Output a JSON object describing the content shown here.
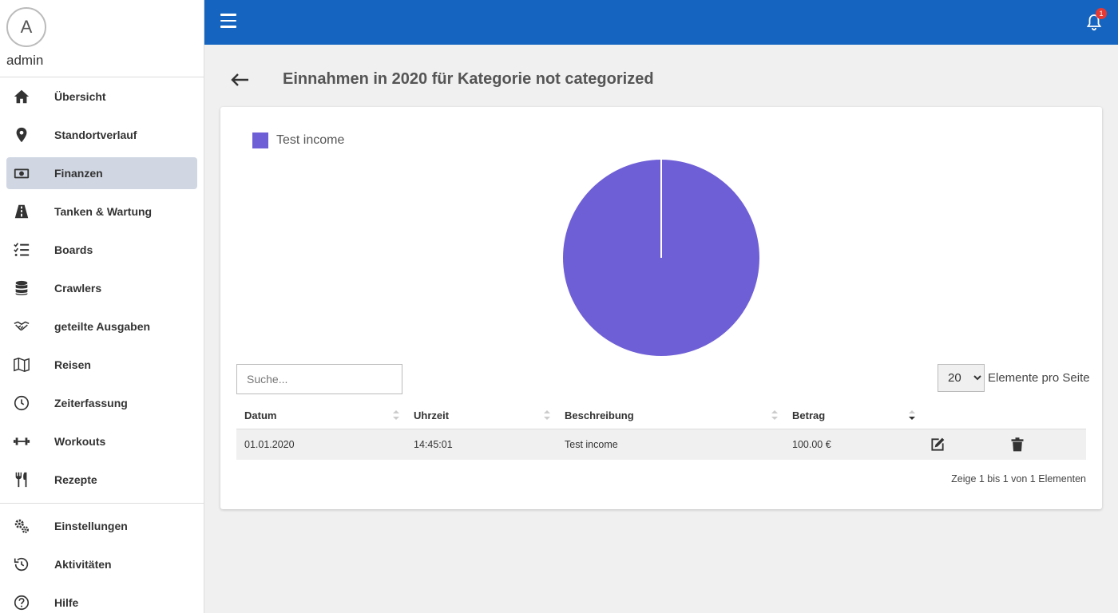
{
  "user": {
    "avatar_letter": "A",
    "name": "admin"
  },
  "nav": {
    "items": [
      {
        "label": "Übersicht",
        "icon": "home-icon"
      },
      {
        "label": "Standortverlauf",
        "icon": "map-pin-icon"
      },
      {
        "label": "Finanzen",
        "icon": "money-icon",
        "active": true
      },
      {
        "label": "Tanken & Wartung",
        "icon": "road-icon"
      },
      {
        "label": "Boards",
        "icon": "checklist-icon"
      },
      {
        "label": "Crawlers",
        "icon": "database-icon"
      },
      {
        "label": "geteilte Ausgaben",
        "icon": "handshake-icon"
      },
      {
        "label": "Reisen",
        "icon": "map-icon"
      },
      {
        "label": "Zeiterfassung",
        "icon": "clock-icon"
      },
      {
        "label": "Workouts",
        "icon": "dumbbell-icon"
      },
      {
        "label": "Rezepte",
        "icon": "utensils-icon"
      }
    ],
    "bottom_items": [
      {
        "label": "Einstellungen",
        "icon": "cogs-icon"
      },
      {
        "label": "Aktivitäten",
        "icon": "history-icon"
      },
      {
        "label": "Hilfe",
        "icon": "help-icon"
      }
    ]
  },
  "topbar": {
    "notification_count": "1",
    "color": "#1565c0"
  },
  "page": {
    "title": "Einnahmen in 2020 für Kategorie not categorized"
  },
  "chart_data": {
    "type": "pie",
    "labels": [
      "Test income"
    ],
    "values": [
      100
    ],
    "colors": [
      "#6f5fd6"
    ],
    "legend": "top-left"
  },
  "table": {
    "search_placeholder": "Suche...",
    "per_page_value": "20",
    "per_page_options": [
      "20"
    ],
    "per_page_label": "Elemente pro Seite",
    "headers": [
      "Datum",
      "Uhrzeit",
      "Beschreibung",
      "Betrag"
    ],
    "rows": [
      {
        "datum": "01.01.2020",
        "uhrzeit": "14:45:01",
        "beschreibung": "Test income",
        "betrag": "100.00 €"
      }
    ],
    "info": "Zeige 1 bis 1 von 1 Elementen"
  }
}
